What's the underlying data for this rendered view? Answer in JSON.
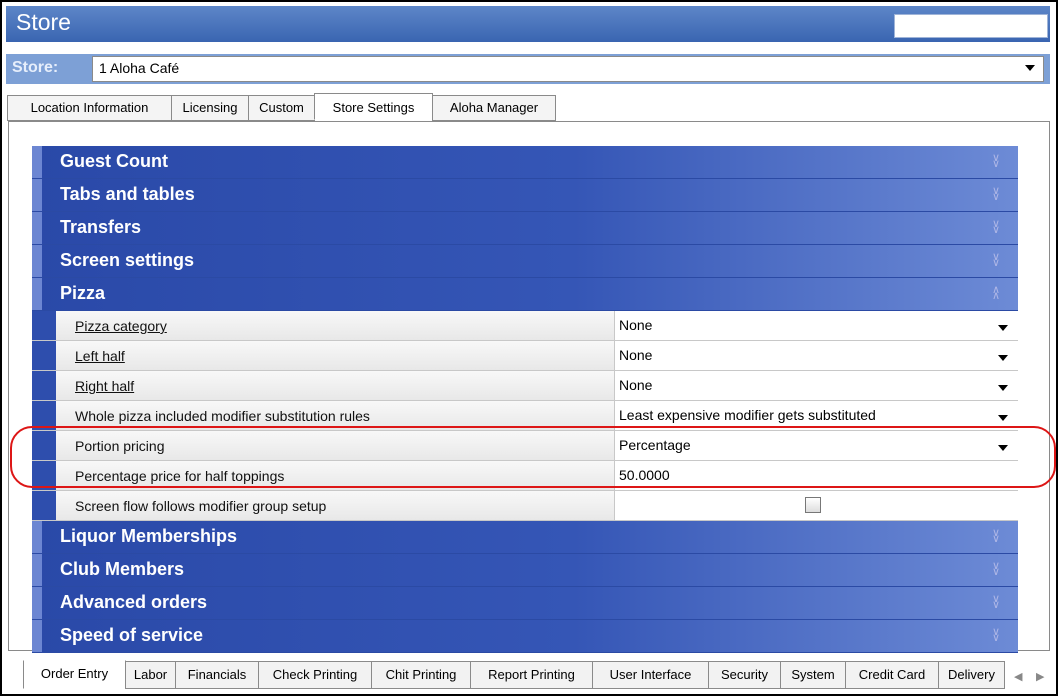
{
  "window": {
    "title": "Store"
  },
  "store": {
    "label": "Store:",
    "value": "1 Aloha Café"
  },
  "top_tabs": [
    {
      "label": "Location Information"
    },
    {
      "label": "Licensing"
    },
    {
      "label": "Custom"
    },
    {
      "label": "Store Settings",
      "active": true
    },
    {
      "label": "Aloha Manager"
    }
  ],
  "sections": {
    "guest_count": "Guest Count",
    "tabs_tables": "Tabs and tables",
    "transfers": "Transfers",
    "screen_settings": "Screen settings",
    "pizza": "Pizza",
    "liquor": "Liquor Memberships",
    "club": "Club Members",
    "advanced": "Advanced orders",
    "speed": "Speed of service"
  },
  "pizza_rows": [
    {
      "label": "Pizza category",
      "value": "None"
    },
    {
      "label": "Left half",
      "value": "None"
    },
    {
      "label": "Right half",
      "value": "None"
    },
    {
      "label": "Whole pizza included modifier substitution rules",
      "value": "Least expensive modifier gets substituted"
    },
    {
      "label": "Portion pricing",
      "value": "Percentage"
    },
    {
      "label": "Percentage price for half toppings",
      "value": "50.0000"
    },
    {
      "label": "Screen flow follows modifier group setup",
      "checked": false
    }
  ],
  "bottom_tabs": [
    {
      "label": "Order Entry",
      "active": true
    },
    {
      "label": "Labor"
    },
    {
      "label": "Financials"
    },
    {
      "label": "Check Printing"
    },
    {
      "label": "Chit Printing"
    },
    {
      "label": "Report Printing"
    },
    {
      "label": "User Interface"
    },
    {
      "label": "Security"
    },
    {
      "label": "System"
    },
    {
      "label": "Credit Card"
    },
    {
      "label": "Delivery"
    }
  ],
  "colors": {
    "accent_blue": "#2a49a8",
    "highlight_red": "#dd1616"
  }
}
